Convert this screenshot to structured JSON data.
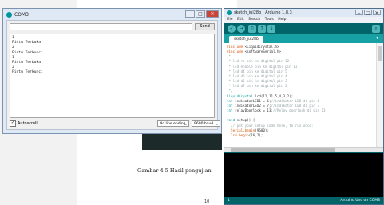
{
  "document": {
    "caption": "Gambar 4.5 Hasil pengujian",
    "page_number": "10"
  },
  "serial_monitor": {
    "title": "COM3",
    "send_label": "Send",
    "input_value": "",
    "output_lines": [
      "1",
      "Pintu Terbuka",
      "2",
      "Pintu Terkunci",
      "1",
      "Pintu Terbuka",
      "2",
      "Pintu Terkunci"
    ],
    "autoscroll_label": "Autoscroll",
    "line_ending": "No line ending",
    "baud": "9600 baud"
  },
  "ide": {
    "title": "sketch_jul28b | Arduino 1.8.3",
    "menu": [
      "File",
      "Edit",
      "Sketch",
      "Tools",
      "Help"
    ],
    "tab_label": "sketch_jul28b",
    "status_line": "1",
    "board": "Arduino Uno on COM3",
    "code": [
      "#include <LiquidCrystal.h>",
      "#include <softwareSerial.h>",
      "/*",
      " * lcd rs pin ke digital pin 12",
      " * lcd enable pin ke digital pin 11",
      " * lcd d4 pin ke digital pin 5",
      " * lcd d5 pin ke digital pin 4",
      " * lcd d6 pin ke digital pin 3",
      " * lcd d7 pin ke digital pin 2",
      " */",
      "LiquidCrystal lcd(12,11,5,4,3,2);",
      "int indikatorLED1 = 6;//indikator LED di pin 6",
      "int indikatorLED2 = 7;//indikator LED di pin 7",
      "int relayDoorlock = 13;//Relay doorlock di pin 13",
      "",
      "void setup() {",
      "  // put your setup code here, to run once:",
      "  Serial.begin(9600);",
      "  lcd.begin(16,2);"
    ]
  },
  "colors": {
    "ide_teal": "#006468",
    "ide_tab": "#17a1a5",
    "close_red": "#c9453a"
  }
}
